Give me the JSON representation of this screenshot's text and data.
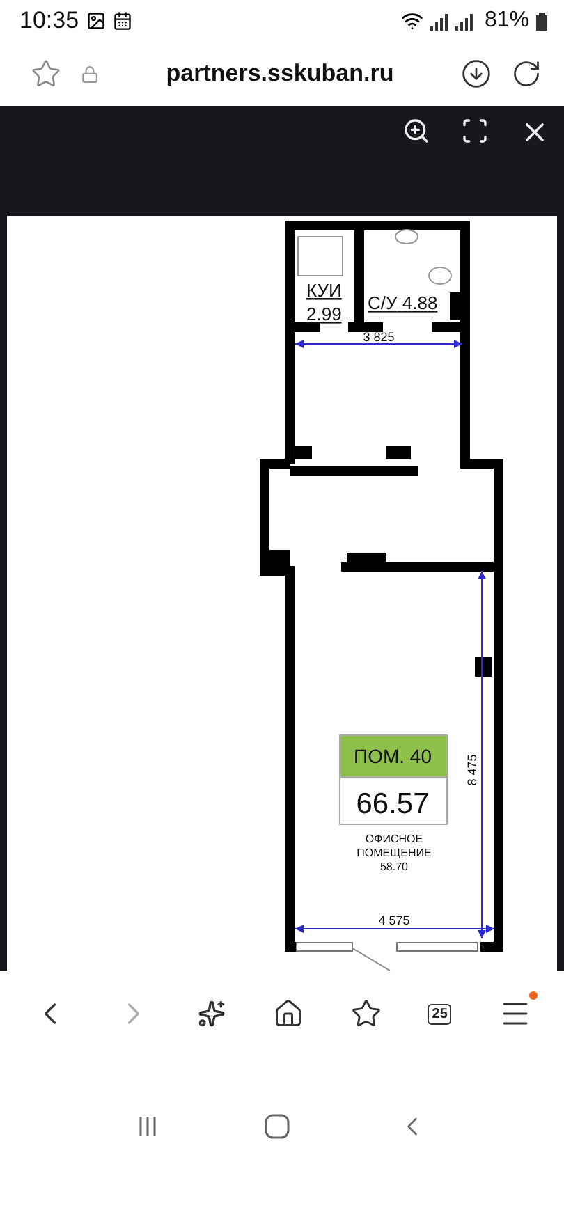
{
  "status_bar": {
    "time": "10:35",
    "battery": "81%"
  },
  "address_bar": {
    "url": "partners.sskuban.ru"
  },
  "floor_plan": {
    "rooms": [
      {
        "name": "КУИ",
        "area": "2.99"
      },
      {
        "name": "С/У",
        "area": "4.88"
      }
    ],
    "unit": {
      "number": "ПОМ. 40",
      "area": "66.57"
    },
    "office": {
      "name_line_1": "ОФИСНОЕ",
      "name_line_2": "ПОМЕЩЕНИЕ",
      "area": "58.70"
    },
    "dimensions": {
      "top_width": "3 825",
      "bottom_width": "4 575",
      "height": "8 475"
    }
  },
  "bottom_bar": {
    "tab_count": "25",
    "menu_notification": true
  }
}
